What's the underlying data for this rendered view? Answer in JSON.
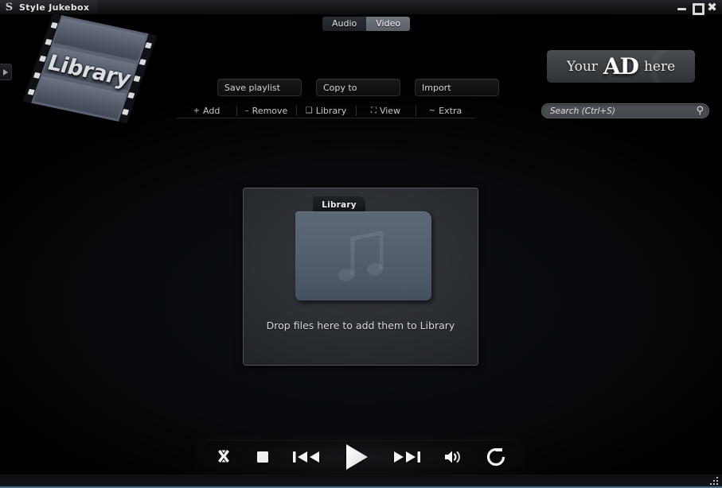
{
  "window": {
    "title": "Style Jukebox",
    "app_icon": "style-jukebox-logo-icon",
    "minimize_label": "–",
    "maximize_label": "□",
    "close_label": "✖"
  },
  "edge_tab": {
    "icon": "expand-panel-arrow-icon"
  },
  "logo": {
    "label": "Library"
  },
  "media_tabs": {
    "selected": "Audio",
    "items": [
      {
        "label": "Audio",
        "state": "selected"
      },
      {
        "label": "Video",
        "state": "unselected"
      }
    ]
  },
  "toolbar": {
    "buttons": [
      {
        "label": "Save playlist"
      },
      {
        "label": "Copy to"
      },
      {
        "label": "Import"
      }
    ]
  },
  "menu": {
    "items": [
      {
        "glyph": "+",
        "label": "Add",
        "icon": "plus-icon"
      },
      {
        "glyph": "–",
        "label": "Remove",
        "icon": "minus-icon"
      },
      {
        "glyph": "❑",
        "label": "Library",
        "icon": "library-icon"
      },
      {
        "glyph": "⛶",
        "label": "View",
        "icon": "view-icon"
      },
      {
        "glyph": "~",
        "label": "Extra",
        "icon": "extra-icon"
      }
    ]
  },
  "ad": {
    "word_1": "Your",
    "word_2": "AD",
    "word_3": "here"
  },
  "search": {
    "value": "",
    "placeholder": "Search (Ctrl+S)",
    "icon": "search-icon"
  },
  "dropzone": {
    "folder_label": "Library",
    "folder_icon": "music-folder-icon",
    "watermark_icon": "music-note-icon",
    "message": "Drop files here to add them to Library"
  },
  "transport": {
    "buttons": [
      {
        "name": "shuffle",
        "icon": "shuffle-icon"
      },
      {
        "name": "stop",
        "icon": "stop-icon"
      },
      {
        "name": "previous",
        "icon": "previous-track-icon"
      },
      {
        "name": "play",
        "icon": "play-icon"
      },
      {
        "name": "next",
        "icon": "next-track-icon"
      },
      {
        "name": "volume",
        "icon": "volume-icon"
      },
      {
        "name": "repeat",
        "icon": "repeat-icon"
      }
    ]
  },
  "statusbar": {
    "text": "",
    "grip_icon": "resize-grip-icon"
  },
  "colors": {
    "background": "#000000",
    "accent_bottom": "#4a6b86",
    "folder_blue": "#566272",
    "panel": "#2b2e32"
  }
}
